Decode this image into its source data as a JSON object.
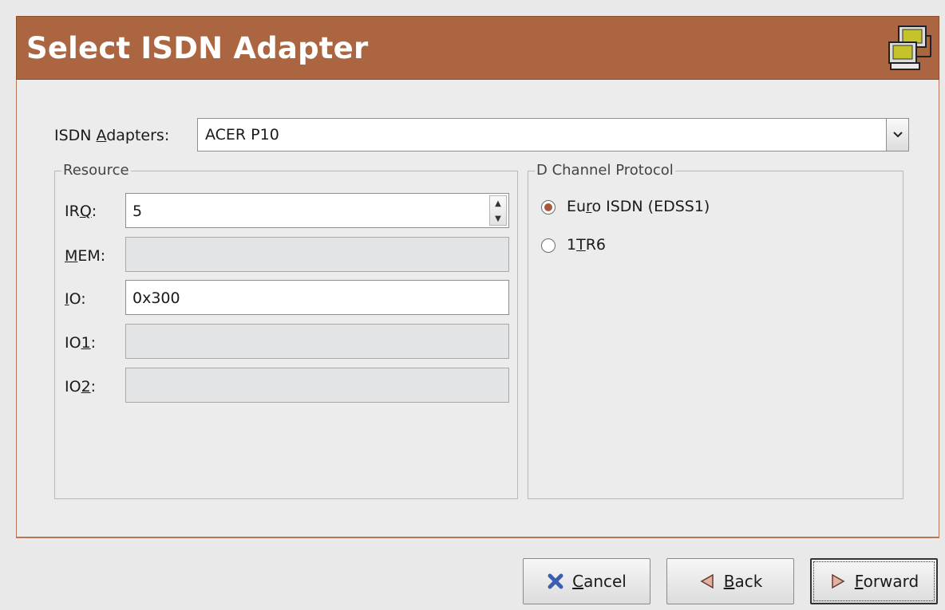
{
  "header": {
    "title": "Select ISDN Adapter",
    "icon": "network-computers-icon"
  },
  "adapters": {
    "label_prefix": "ISDN ",
    "label_accel": "A",
    "label_suffix": "dapters:",
    "selected": "ACER P10"
  },
  "resource": {
    "title": "Resource",
    "irq": {
      "label_pre": "IR",
      "label_accel": "Q",
      "label_post": ":",
      "value": "5"
    },
    "mem": {
      "label_pre": "",
      "label_accel": "M",
      "label_post": "EM:",
      "value": ""
    },
    "io": {
      "label_pre": "",
      "label_accel": "I",
      "label_post": "O:",
      "value": "0x300"
    },
    "io1": {
      "label_pre": "IO",
      "label_accel": "1",
      "label_post": ":",
      "value": ""
    },
    "io2": {
      "label_pre": "IO",
      "label_accel": "2",
      "label_post": ":",
      "value": ""
    }
  },
  "protocol": {
    "title": "D Channel Protocol",
    "options": [
      {
        "pre": "Eu",
        "accel": "r",
        "post": "o ISDN (EDSS1)",
        "selected": true
      },
      {
        "pre": "1",
        "accel": "T",
        "post": "R6",
        "selected": false
      }
    ]
  },
  "buttons": {
    "cancel": {
      "accel": "C",
      "rest": "ancel"
    },
    "back": {
      "accel": "B",
      "rest": "ack"
    },
    "forward": {
      "accel": "F",
      "rest": "orward"
    }
  },
  "colors": {
    "header_bg": "#ab6541",
    "radio_selected": "#a6583a",
    "cancel_icon": "#3a5fb0"
  }
}
